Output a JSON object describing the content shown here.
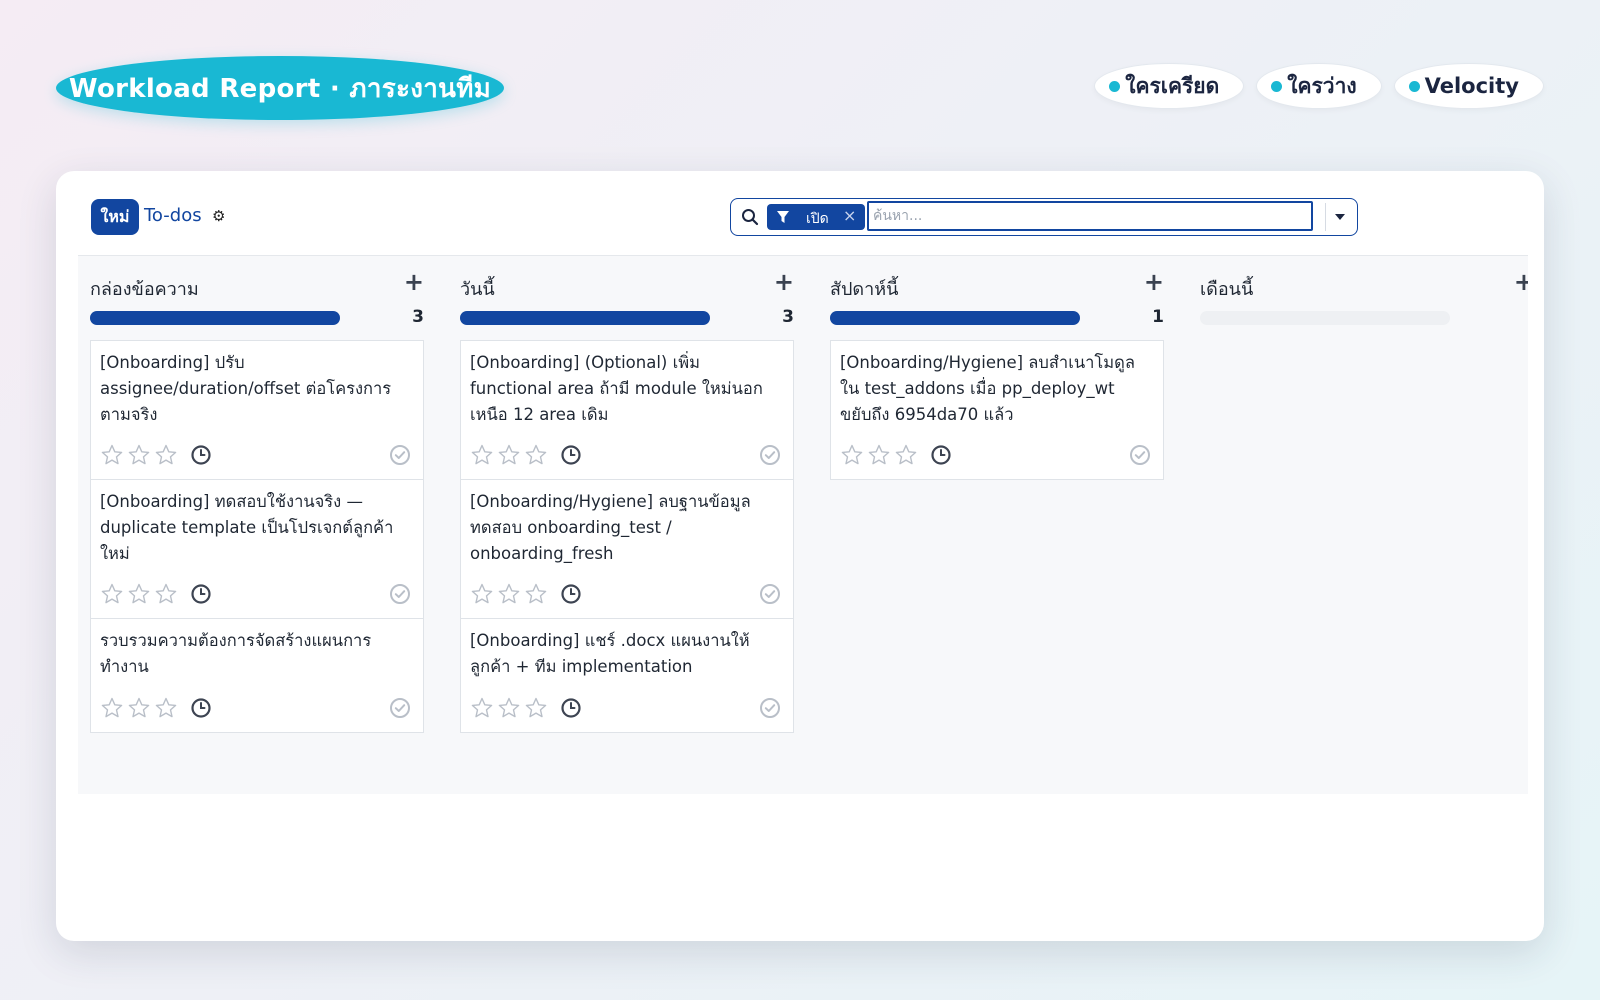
{
  "header": {
    "title": "Workload Report · ภาระงานทีม",
    "pills": [
      {
        "label": "ใครเครียด"
      },
      {
        "label": "ใครว่าง"
      },
      {
        "label": "Velocity"
      }
    ]
  },
  "control_panel": {
    "new_button": "ใหม่",
    "breadcrumb": "To-dos",
    "search": {
      "facet_label": "เปิด",
      "placeholder": "ค้นหา..."
    }
  },
  "columns": [
    {
      "title": "กล่องข้อความ",
      "count": "3",
      "progress": 1.0,
      "cards": [
        {
          "title": "[Onboarding] ปรับ assignee/duration/offset ต่อโครงการตามจริง"
        },
        {
          "title": "[Onboarding] ทดสอบใช้งานจริง — duplicate template เป็นโปรเจกต์ลูกค้าใหม่"
        },
        {
          "title": "รวบรวมความต้องการจัดสร้างแผนการทำงาน"
        }
      ]
    },
    {
      "title": "วันนี้",
      "count": "3",
      "progress": 1.0,
      "cards": [
        {
          "title": "[Onboarding] (Optional) เพิ่ม functional area ถ้ามี module ใหม่นอกเหนือ 12 area เดิม"
        },
        {
          "title": "[Onboarding/Hygiene] ลบฐานข้อมูลทดสอบ onboarding_test / onboarding_fresh"
        },
        {
          "title": "[Onboarding] แชร์ .docx แผนงานให้ลูกค้า + ทีม implementation"
        }
      ]
    },
    {
      "title": "สัปดาห์นี้",
      "count": "1",
      "progress": 1.0,
      "cards": [
        {
          "title": "[Onboarding/Hygiene] ลบสำเนาโมดูลใน test_addons เมื่อ pp_deploy_wt ขยับถึง 6954da70 แล้ว"
        }
      ]
    },
    {
      "title": "เดือนนี้",
      "count": "",
      "progress": 0.0,
      "cards": []
    }
  ],
  "colors": {
    "brand": "#1246a0",
    "accent": "#19b8d3"
  },
  "icons": {
    "search": "search-icon",
    "filter": "filter-icon",
    "settings": "gear-icon",
    "add": "plus-icon",
    "priority": "star-icon",
    "activity": "clock-icon",
    "state": "check-circle-icon"
  }
}
